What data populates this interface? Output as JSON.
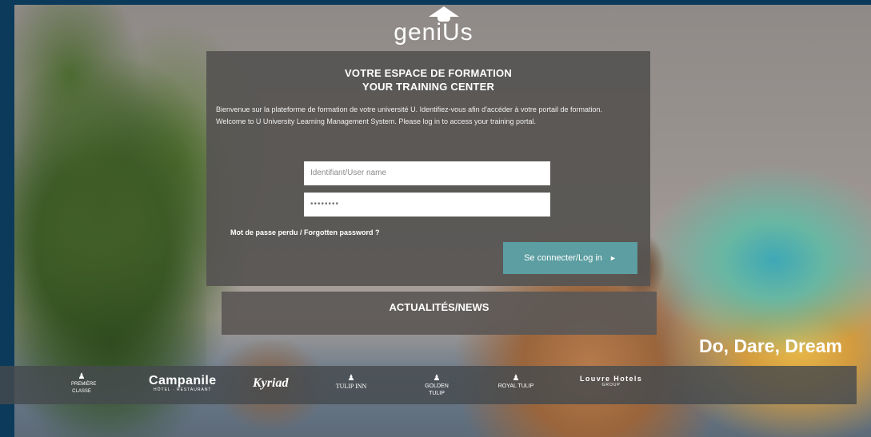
{
  "logo": {
    "text": "geniUs"
  },
  "login": {
    "title_fr": "VOTRE ESPACE DE FORMATION",
    "title_en": "YOUR TRAINING CENTER",
    "intro_fr": "Bienvenue sur la plateforme de formation de votre université U. Identifiez-vous afin d'accéder à votre portail de formation.",
    "intro_en": "Welcome to U University Learning Management System. Please log in to access your training portal.",
    "username_placeholder": "Identifiant/User name",
    "password_value": "••••••••",
    "forgot_label": "Mot de passe perdu / Forgotten password ?",
    "login_label": "Se connecter/Log in",
    "login_arrow": "►"
  },
  "news": {
    "label": "ACTUALITÉS/NEWS"
  },
  "slogan": "Do, Dare, Dream",
  "brands": {
    "b1_glyph": "♟",
    "b1_text": "PREMIÈRE CLASSE",
    "campanile": "Campanile",
    "campanile_sub": "HÔTEL · RESTAURANT",
    "kyriad": "Kyriad",
    "tulip_glyph": "♟",
    "tulip": "TULIP INN",
    "golden_glyph": "♟",
    "golden": "GOLDEN TULIP",
    "hotelgrand_glyph": "♟",
    "hotelgrand": "ROYAL TULIP",
    "louvre": "Louvre Hotels",
    "louvre_sub": "GROUP"
  }
}
